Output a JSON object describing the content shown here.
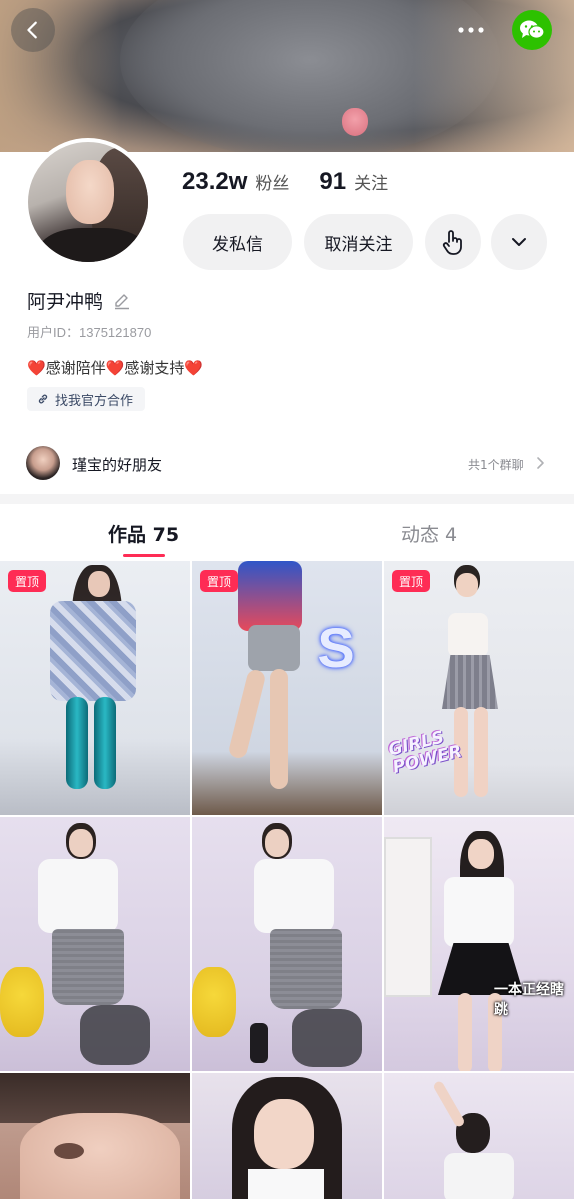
{
  "header": {
    "back_icon": "chevron-left-icon",
    "more_icon": "more-dots-icon",
    "share_icon": "wechat-icon",
    "share_color": "#2dc100"
  },
  "profile": {
    "followers_count": "23.2w",
    "followers_label": "粉丝",
    "following_count": "91",
    "following_label": "关注",
    "message_button": "发私信",
    "unfollow_button": "取消关注",
    "name": "阿尹冲鸭",
    "user_id": "用户ID：1375121870",
    "bio_parts": [
      "❤️",
      "感谢陪伴",
      "❤️",
      "感谢支持",
      "❤️"
    ],
    "link_label": "找我官方合作"
  },
  "group": {
    "name": "瑾宝的好朋友",
    "count": "共1个群聊"
  },
  "tabs": {
    "works_label": "作品 75",
    "moments_label": "动态 4",
    "accent": "#fe2c55"
  },
  "grid": {
    "pinned_label": "置顶",
    "stickers": {
      "s_letter": "S",
      "girls_power_1": "GIRLS",
      "girls_power_2": "POWER",
      "caption": "一本正经瞎跳"
    }
  }
}
